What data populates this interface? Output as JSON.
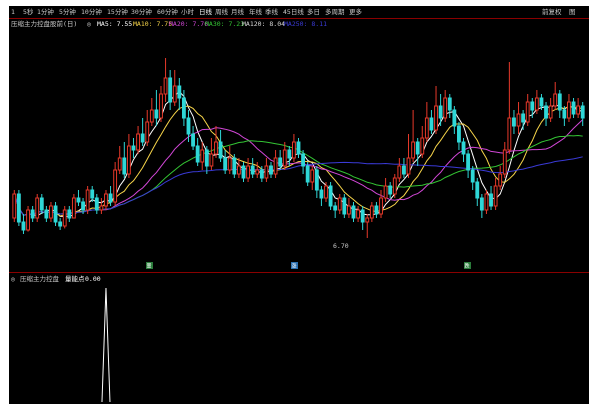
{
  "colors": {
    "bg": "#000000",
    "up": "#e8392a",
    "down": "#2fd7d7",
    "ma5": "#ffffff",
    "ma10": "#f7d54a",
    "ma20": "#d247d7",
    "ma30": "#34c534",
    "ma120": "#3a3ad6"
  },
  "toolbar": {
    "tabs": [
      {
        "label": "1",
        "active": false
      },
      {
        "label": "5秒",
        "active": false
      },
      {
        "label": "1分钟",
        "active": false
      },
      {
        "label": "5分钟",
        "active": false
      },
      {
        "label": "10分钟",
        "active": false
      },
      {
        "label": "15分钟",
        "active": false
      },
      {
        "label": "30分钟",
        "active": false
      },
      {
        "label": "60分钟",
        "active": false
      },
      {
        "label": "小时",
        "active": false
      },
      {
        "label": "日线",
        "active": true
      },
      {
        "label": "周线",
        "active": false
      },
      {
        "label": "月线",
        "active": false
      },
      {
        "label": "年线",
        "active": false
      },
      {
        "label": "季线",
        "active": false
      },
      {
        "label": "45日线",
        "active": false
      },
      {
        "label": "多日",
        "active": false
      },
      {
        "label": "多周期",
        "active": false
      },
      {
        "label": "更多",
        "active": false
      }
    ],
    "right": [
      "前复权",
      "图"
    ]
  },
  "indicator_bar": {
    "name": "压缩主力控盘股前(日)",
    "values": [
      {
        "label": "MA5: 7.55",
        "color": "#ffffff"
      },
      {
        "label": "MA10: 7.75",
        "color": "#f7d54a"
      },
      {
        "label": "MA20: 7.76",
        "color": "#d247d7"
      },
      {
        "label": "MA30: 7.23",
        "color": "#34c534"
      },
      {
        "label": "MA120: 8.04",
        "color": "#d9d9d9"
      },
      {
        "label": "MA250: 8.11",
        "color": "#3a3ad6"
      }
    ]
  },
  "price_label": "6.70",
  "markers": [
    "量",
    "涨",
    "跌"
  ],
  "sub_indicator": {
    "name": "压缩主力控盘",
    "label": "量能点",
    "value": "0.00"
  },
  "chart_data": {
    "type": "candlestick",
    "candles": [
      [
        6.95,
        7.25,
        7.3,
        6.9
      ],
      [
        7.25,
        6.9,
        7.3,
        6.85
      ],
      [
        6.9,
        6.8,
        7.0,
        6.75
      ],
      [
        6.8,
        7.05,
        7.1,
        6.78
      ],
      [
        7.05,
        6.95,
        7.1,
        6.9
      ],
      [
        6.95,
        7.2,
        7.25,
        6.9
      ],
      [
        7.2,
        7.05,
        7.25,
        7.0
      ],
      [
        7.05,
        6.95,
        7.1,
        6.9
      ],
      [
        6.95,
        7.1,
        7.15,
        6.9
      ],
      [
        7.1,
        6.9,
        7.15,
        6.85
      ],
      [
        6.9,
        6.85,
        6.95,
        6.8
      ],
      [
        6.85,
        7.05,
        7.1,
        6.82
      ],
      [
        7.05,
        6.95,
        7.1,
        6.9
      ],
      [
        6.95,
        7.2,
        7.25,
        6.95
      ],
      [
        7.2,
        7.15,
        7.3,
        7.1
      ],
      [
        7.15,
        7.05,
        7.2,
        7.0
      ],
      [
        7.05,
        7.3,
        7.35,
        7.0
      ],
      [
        7.3,
        7.2,
        7.35,
        7.15
      ],
      [
        7.2,
        7.05,
        7.25,
        7.0
      ],
      [
        7.05,
        7.1,
        7.2,
        7.0
      ],
      [
        7.1,
        7.25,
        7.3,
        7.05
      ],
      [
        7.25,
        7.15,
        7.35,
        7.1
      ],
      [
        7.15,
        7.55,
        7.65,
        7.1
      ],
      [
        7.55,
        7.7,
        7.85,
        7.5
      ],
      [
        7.7,
        7.5,
        7.9,
        7.45
      ],
      [
        7.5,
        7.85,
        8.0,
        7.45
      ],
      [
        7.85,
        7.8,
        7.95,
        7.7
      ],
      [
        7.8,
        8.0,
        8.1,
        7.75
      ],
      [
        8.0,
        7.9,
        8.2,
        7.85
      ],
      [
        7.9,
        8.15,
        8.3,
        7.85
      ],
      [
        8.15,
        8.3,
        8.45,
        8.1
      ],
      [
        8.3,
        8.2,
        8.55,
        8.1
      ],
      [
        8.2,
        8.5,
        8.6,
        8.15
      ],
      [
        8.5,
        8.7,
        8.95,
        8.4
      ],
      [
        8.7,
        8.4,
        8.8,
        8.3
      ],
      [
        8.4,
        8.6,
        8.8,
        8.35
      ],
      [
        8.6,
        8.45,
        8.7,
        8.3
      ],
      [
        8.45,
        8.2,
        8.55,
        8.1
      ],
      [
        8.2,
        8.0,
        8.3,
        7.9
      ],
      [
        8.0,
        7.85,
        8.1,
        7.8
      ],
      [
        7.85,
        7.65,
        7.95,
        7.6
      ],
      [
        7.65,
        7.8,
        7.9,
        7.55
      ],
      [
        7.8,
        7.6,
        7.85,
        7.5
      ],
      [
        7.6,
        7.75,
        7.95,
        7.55
      ],
      [
        7.75,
        7.9,
        8.1,
        7.7
      ],
      [
        7.9,
        7.7,
        8.05,
        7.65
      ],
      [
        7.7,
        7.55,
        7.8,
        7.5
      ],
      [
        7.55,
        7.7,
        7.85,
        7.5
      ],
      [
        7.7,
        7.5,
        7.75,
        7.45
      ],
      [
        7.5,
        7.6,
        7.7,
        7.45
      ],
      [
        7.6,
        7.45,
        7.65,
        7.4
      ],
      [
        7.45,
        7.6,
        7.7,
        7.4
      ],
      [
        7.6,
        7.5,
        7.7,
        7.45
      ],
      [
        7.5,
        7.55,
        7.65,
        7.45
      ],
      [
        7.55,
        7.45,
        7.6,
        7.4
      ],
      [
        7.45,
        7.6,
        7.7,
        7.4
      ],
      [
        7.6,
        7.5,
        7.65,
        7.45
      ],
      [
        7.5,
        7.7,
        7.8,
        7.45
      ],
      [
        7.7,
        7.6,
        7.8,
        7.55
      ],
      [
        7.6,
        7.8,
        7.9,
        7.55
      ],
      [
        7.8,
        7.7,
        7.85,
        7.6
      ],
      [
        7.7,
        7.9,
        8.0,
        7.65
      ],
      [
        7.9,
        7.75,
        7.95,
        7.7
      ],
      [
        7.75,
        7.6,
        7.8,
        7.5
      ],
      [
        7.6,
        7.4,
        7.65,
        7.35
      ],
      [
        7.4,
        7.55,
        7.6,
        7.3
      ],
      [
        7.55,
        7.3,
        7.6,
        7.2
      ],
      [
        7.3,
        7.2,
        7.35,
        7.1
      ],
      [
        7.2,
        7.35,
        7.4,
        7.15
      ],
      [
        7.35,
        7.1,
        7.4,
        7.05
      ],
      [
        7.1,
        7.05,
        7.15,
        6.95
      ],
      [
        7.05,
        7.2,
        7.25,
        7.0
      ],
      [
        7.2,
        7.0,
        7.25,
        6.95
      ],
      [
        7.0,
        7.1,
        7.2,
        6.95
      ],
      [
        7.1,
        6.95,
        7.15,
        6.9
      ],
      [
        6.95,
        7.05,
        7.1,
        6.9
      ],
      [
        7.05,
        6.9,
        7.1,
        6.8
      ],
      [
        6.9,
        6.95,
        7.0,
        6.7
      ],
      [
        6.95,
        7.1,
        7.15,
        6.9
      ],
      [
        7.1,
        7.0,
        7.15,
        6.95
      ],
      [
        7.0,
        7.2,
        7.3,
        6.95
      ],
      [
        7.2,
        7.35,
        7.45,
        7.15
      ],
      [
        7.35,
        7.25,
        7.4,
        7.2
      ],
      [
        7.25,
        7.45,
        7.5,
        7.2
      ],
      [
        7.45,
        7.6,
        7.7,
        7.4
      ],
      [
        7.6,
        7.5,
        7.7,
        7.45
      ],
      [
        7.5,
        7.7,
        8.0,
        7.45
      ],
      [
        7.7,
        7.9,
        8.3,
        7.65
      ],
      [
        7.9,
        7.75,
        7.95,
        7.6
      ],
      [
        7.75,
        7.95,
        8.1,
        7.7
      ],
      [
        7.95,
        8.2,
        8.4,
        7.9
      ],
      [
        8.2,
        8.05,
        8.3,
        8.0
      ],
      [
        8.05,
        8.35,
        8.6,
        8.0
      ],
      [
        8.35,
        8.2,
        8.5,
        8.1
      ],
      [
        8.2,
        8.45,
        8.55,
        8.15
      ],
      [
        8.45,
        8.3,
        8.5,
        8.2
      ],
      [
        8.3,
        8.1,
        8.35,
        8.0
      ],
      [
        8.1,
        7.9,
        8.15,
        7.8
      ],
      [
        7.9,
        7.75,
        7.95,
        7.65
      ],
      [
        7.75,
        7.55,
        7.8,
        7.45
      ],
      [
        7.55,
        7.4,
        7.6,
        7.3
      ],
      [
        7.4,
        7.2,
        7.45,
        7.1
      ],
      [
        7.2,
        7.05,
        7.25,
        6.95
      ],
      [
        7.05,
        7.25,
        7.3,
        7.0
      ],
      [
        7.25,
        7.1,
        7.35,
        7.05
      ],
      [
        7.1,
        7.35,
        7.45,
        7.05
      ],
      [
        7.35,
        7.5,
        7.6,
        7.3
      ],
      [
        7.5,
        7.8,
        7.9,
        7.45
      ],
      [
        7.8,
        8.2,
        8.9,
        7.75
      ],
      [
        8.2,
        8.1,
        8.3,
        8.0
      ],
      [
        8.1,
        8.25,
        8.4,
        8.0
      ],
      [
        8.25,
        8.15,
        8.3,
        8.05
      ],
      [
        8.15,
        8.4,
        8.5,
        8.1
      ],
      [
        8.4,
        8.3,
        8.45,
        8.2
      ],
      [
        8.3,
        8.45,
        8.55,
        8.25
      ],
      [
        8.45,
        8.35,
        8.5,
        8.3
      ],
      [
        8.35,
        8.2,
        8.4,
        8.1
      ],
      [
        8.2,
        8.35,
        8.45,
        8.15
      ],
      [
        8.35,
        8.5,
        8.65,
        8.3
      ],
      [
        8.5,
        8.3,
        8.55,
        8.2
      ],
      [
        8.3,
        8.2,
        8.35,
        8.1
      ],
      [
        8.2,
        8.4,
        8.5,
        8.15
      ],
      [
        8.4,
        8.25,
        8.45,
        8.2
      ],
      [
        8.25,
        8.35,
        8.45,
        8.2
      ],
      [
        8.35,
        8.2,
        8.4,
        8.1
      ]
    ],
    "ma_series": [
      {
        "name": "MA5",
        "period": 5,
        "color": "#ffffff"
      },
      {
        "name": "MA10",
        "period": 10,
        "color": "#f7d54a"
      },
      {
        "name": "MA20",
        "period": 20,
        "color": "#d247d7"
      },
      {
        "name": "MA30",
        "period": 30,
        "color": "#34c534"
      },
      {
        "name": "MA250",
        "period": 60,
        "color": "#3a3ad6"
      }
    ],
    "ylim": [
      6.5,
      9.2
    ],
    "sub_series": {
      "spike_index": 20,
      "value": 1.0,
      "ylim": [
        0,
        1.0
      ]
    }
  }
}
